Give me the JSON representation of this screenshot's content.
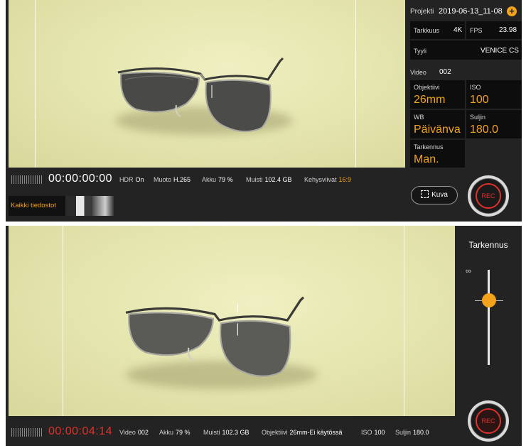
{
  "screen1": {
    "project_label": "Projekti",
    "project_value": "2019-06-13_11-08",
    "add_icon": "plus-icon",
    "resolution_label": "Tarkkuus",
    "resolution_value": "4K",
    "fps_label": "FPS",
    "fps_value": "23.98",
    "style_label": "Tyyli",
    "style_value": "VENICE CS",
    "video_label": "Video",
    "video_value": "002",
    "lens_label": "Objektiivi",
    "lens_value": "26mm",
    "iso_label": "ISO",
    "iso_value": "100",
    "wb_label": "WB",
    "wb_value": "Päivänva",
    "shutter_label": "Suljin",
    "shutter_value": "180.0",
    "focus_label": "Tarkennus",
    "focus_value": "Man.",
    "timecode": "00:00:00:00",
    "hdr_label": "HDR",
    "hdr_value": "On",
    "format_label": "Muoto",
    "format_value": "H.265",
    "battery_label": "Akku",
    "battery_value": "79 %",
    "memory_label": "Muisti",
    "memory_value": "102.4 GB",
    "framelines_label": "Kehysviivat",
    "framelines_value": "16:9",
    "all_files_label": "Kaikki tiedostot",
    "photo_button_label": "Kuva",
    "rec_label": "REC"
  },
  "screen2": {
    "focus_title": "Tarkennus",
    "infinity_symbol": "∞",
    "focus_slider_level": 0.68,
    "timecode": "00:00:04:14",
    "video_label": "Video",
    "video_value": "002",
    "battery_label": "Akku",
    "battery_value": "79 %",
    "memory_label": "Muisti",
    "memory_value": "102.3 GB",
    "lens_label": "Objektiivi",
    "lens_value": "26mm-Ei käytössä",
    "iso_label": "ISO",
    "iso_value": "100",
    "shutter_label": "Suljin",
    "shutter_value": "180.0",
    "rec_label": "REC"
  },
  "colors": {
    "accent": "#f3a31b",
    "recording": "#e0312b",
    "panel": "#232323"
  }
}
